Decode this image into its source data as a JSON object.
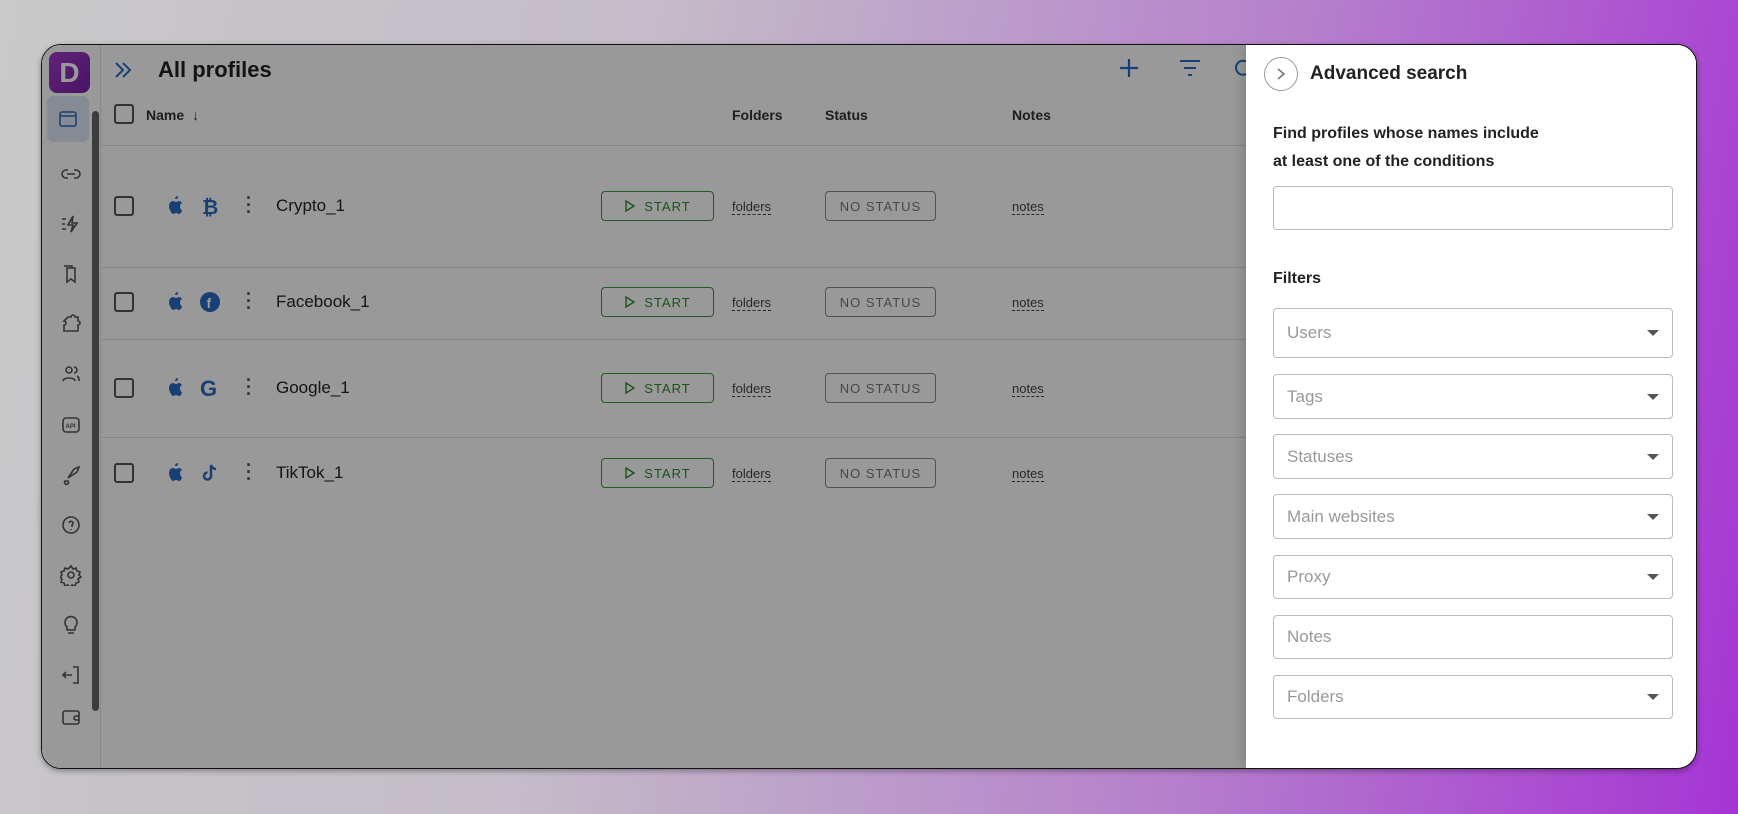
{
  "app": {
    "logo_letter": "D",
    "title": "All profiles"
  },
  "sidebar": {
    "items": [
      "profiles",
      "links",
      "automation",
      "templates",
      "extensions",
      "team",
      "api",
      "launch",
      "help",
      "settings",
      "tips",
      "logout",
      "wallet"
    ]
  },
  "table": {
    "columns": {
      "name": "Name",
      "folders": "Folders",
      "status": "Status",
      "notes": "Notes"
    },
    "rows": [
      {
        "name": "Crypto_1",
        "os_icon": "apple-icon",
        "site_icon": "bitcoin-icon",
        "start": "START",
        "folders": "folders",
        "status": "NO STATUS",
        "notes": "notes"
      },
      {
        "name": "Facebook_1",
        "os_icon": "apple-icon",
        "site_icon": "facebook-icon",
        "start": "START",
        "folders": "folders",
        "status": "NO STATUS",
        "notes": "notes"
      },
      {
        "name": "Google_1",
        "os_icon": "apple-icon",
        "site_icon": "google-icon",
        "start": "START",
        "folders": "folders",
        "status": "NO STATUS",
        "notes": "notes"
      },
      {
        "name": "TikTok_1",
        "os_icon": "apple-icon",
        "site_icon": "tiktok-icon",
        "start": "START",
        "folders": "folders",
        "status": "NO STATUS",
        "notes": "notes"
      }
    ]
  },
  "panel": {
    "title": "Advanced search",
    "description_line1": "Find profiles whose names include",
    "description_line2": "at least one of the conditions",
    "search_value": "",
    "filters_label": "Filters",
    "filters": [
      {
        "label": "Users",
        "dropdown": true
      },
      {
        "label": "Tags",
        "dropdown": true
      },
      {
        "label": "Statuses",
        "dropdown": true
      },
      {
        "label": "Main websites",
        "dropdown": true
      },
      {
        "label": "Proxy",
        "dropdown": true
      },
      {
        "label": "Notes",
        "dropdown": false
      },
      {
        "label": "Folders",
        "dropdown": true
      }
    ]
  },
  "colors": {
    "accent": "#2b6cc4",
    "start": "#2e8b2e",
    "brand": "#8e2fbf"
  }
}
